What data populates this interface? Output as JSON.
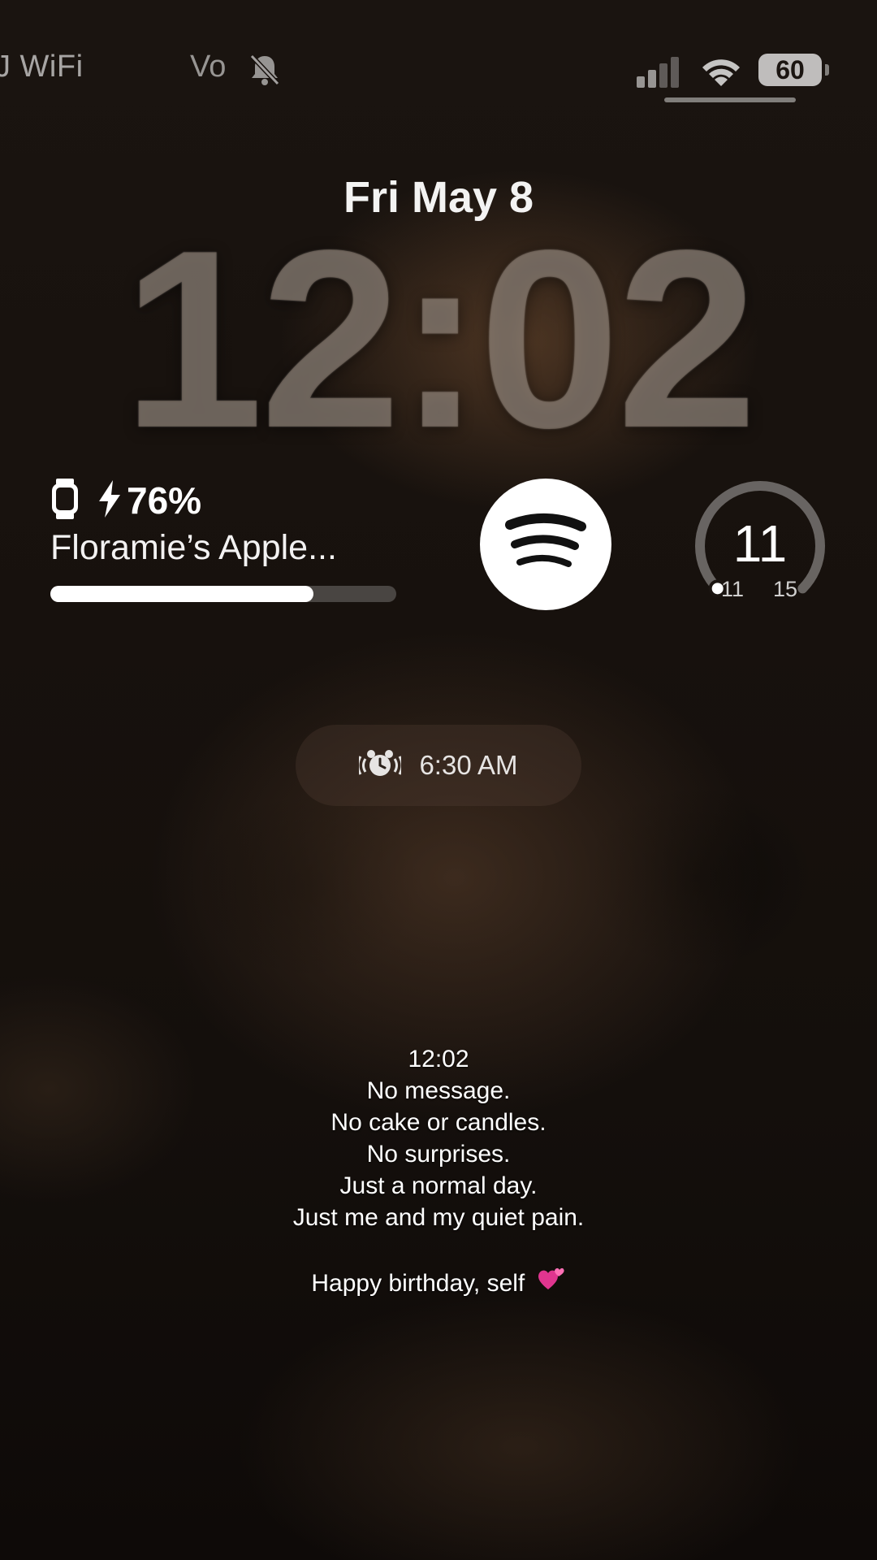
{
  "status_bar": {
    "carrier": "J WiFi",
    "network": "Vo",
    "silent_icon": "bell-slash-icon",
    "signal_icon": "cellular-signal-icon",
    "wifi_icon": "wifi-icon",
    "battery_percent": "60"
  },
  "lock_screen": {
    "date": "Fri May 8",
    "time": "12:02"
  },
  "widgets": {
    "watch": {
      "icon": "apple-watch-icon",
      "charging_icon": "bolt-icon",
      "battery": "76%",
      "battery_level": 0.76,
      "name": "Floramie’s Apple..."
    },
    "spotify": {
      "icon": "spotify-icon"
    },
    "gauge": {
      "value": "11",
      "min": "11",
      "max": "15",
      "level": 0.0
    }
  },
  "alarm": {
    "icon": "alarm-clock-icon",
    "time": "6:30 AM"
  },
  "caption": {
    "lines": [
      "12:02",
      "No message.",
      "No cake or candles.",
      "No surprises.",
      "Just a normal day.",
      "Just me and my quiet pain."
    ],
    "closing": "Happy birthday, self",
    "closing_icon": "two-hearts-emoji"
  },
  "colors": {
    "background": "#120d0a",
    "spotify_bg": "#ffffff",
    "heart": "#e0358f"
  }
}
